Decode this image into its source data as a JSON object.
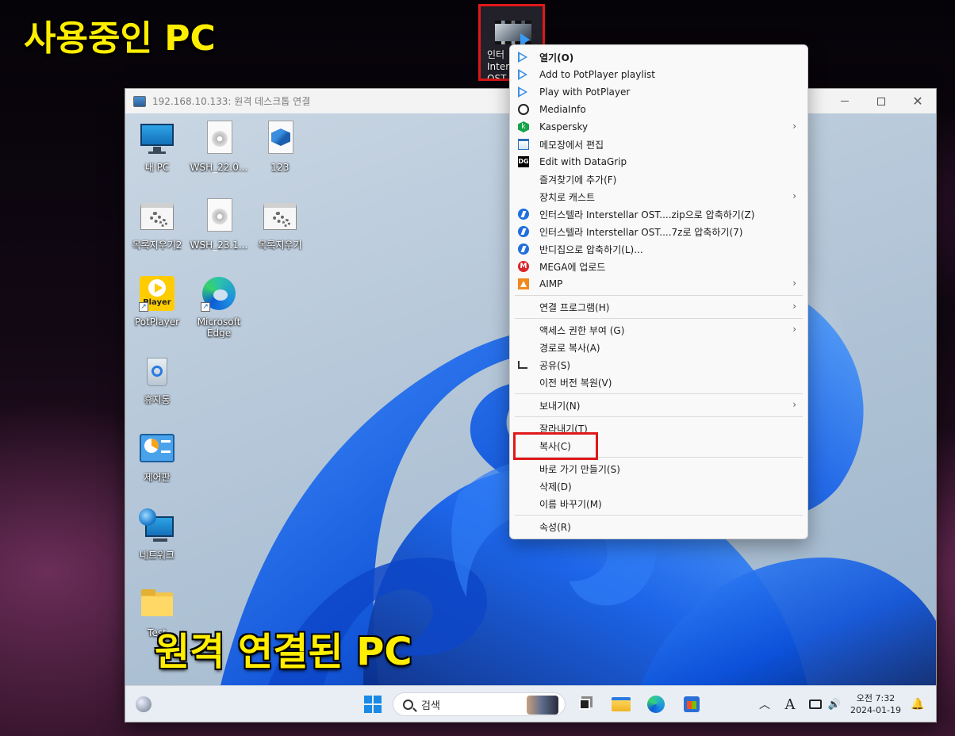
{
  "overlays": {
    "top_label": "사용중인 PC",
    "bottom_label": "원격 연결된 PC"
  },
  "host_icon": {
    "name": "인터\nInter\nOST\nSten"
  },
  "rdp_window": {
    "title": "192.168.10.133: 원격 데스크톱 연결",
    "minimize": "minimize",
    "maximize": "maximize",
    "close": "✕"
  },
  "desktop_icons": [
    {
      "label": "내 PC",
      "icon": "monitor-icon"
    },
    {
      "label": "WSH_22.0...",
      "icon": "document-disc-icon"
    },
    {
      "label": "123",
      "icon": "document-cubes-icon"
    },
    {
      "label": "목록지우기2",
      "icon": "gear-window-icon"
    },
    {
      "label": "WSH_23.1...",
      "icon": "document-disc-icon"
    },
    {
      "label": "목록지우기",
      "icon": "gear-window-icon"
    },
    {
      "label": "PotPlayer",
      "icon": "potplayer-icon",
      "badge": "Player"
    },
    {
      "label": "Microsoft\nEdge",
      "icon": "edge-icon"
    },
    {
      "label": "휴지통",
      "icon": "recycle-bin-icon"
    },
    {
      "label": "제어판",
      "icon": "control-panel-icon"
    },
    {
      "label": "네트워크",
      "icon": "network-icon"
    },
    {
      "label": "Test",
      "icon": "folder-icon"
    }
  ],
  "taskbar": {
    "search_placeholder": "검색",
    "clock_time": "오전 7:32",
    "clock_date": "2024-01-19",
    "ime": "A",
    "chevron": "︿",
    "volume": "🔊",
    "bell": "🔔"
  },
  "context_menu": {
    "items": [
      {
        "label": "열기(O)",
        "icon": "play-icon",
        "bold": true
      },
      {
        "label": "Add to PotPlayer playlist",
        "icon": "play-icon"
      },
      {
        "label": "Play with PotPlayer",
        "icon": "play-icon"
      },
      {
        "label": "MediaInfo",
        "icon": "mediainfo-icon"
      },
      {
        "label": "Kaspersky",
        "icon": "kaspersky-icon",
        "submenu": true,
        "icon_text": "k"
      },
      {
        "label": "메모장에서 편집",
        "icon": "notepad-icon"
      },
      {
        "label": "Edit with DataGrip",
        "icon": "datagrip-icon",
        "icon_text": "DG"
      },
      {
        "label": "즐겨찾기에 추가(F)",
        "icon": ""
      },
      {
        "label": "장치로 캐스트",
        "icon": "",
        "submenu": true
      },
      {
        "label": "인터스텔라 Interstellar OST....zip으로 압축하기(Z)",
        "icon": "bandizip-icon"
      },
      {
        "label": "인터스텔라 Interstellar OST....7z로 압축하기(7)",
        "icon": "bandizip-icon"
      },
      {
        "label": "반디집으로 압축하기(L)...",
        "icon": "bandizip-icon"
      },
      {
        "label": "MEGA에 업로드",
        "icon": "mega-icon",
        "icon_text": "M"
      },
      {
        "label": "AIMP",
        "icon": "aimp-icon",
        "submenu": true
      },
      {
        "sep": true
      },
      {
        "label": "연결 프로그램(H)",
        "icon": "",
        "submenu": true
      },
      {
        "sep": true
      },
      {
        "label": "액세스 권한 부여 (G)",
        "icon": "",
        "submenu": true
      },
      {
        "label": "경로로 복사(A)",
        "icon": ""
      },
      {
        "label": "공유(S)",
        "icon": "share-icon"
      },
      {
        "label": "이전 버전 복원(V)",
        "icon": ""
      },
      {
        "sep": true
      },
      {
        "label": "보내기(N)",
        "icon": "",
        "submenu": true
      },
      {
        "sep": true
      },
      {
        "label": "잘라내기(T)",
        "icon": ""
      },
      {
        "label": "복사(C)",
        "icon": ""
      },
      {
        "sep": true
      },
      {
        "label": "바로 가기 만들기(S)",
        "icon": ""
      },
      {
        "label": "삭제(D)",
        "icon": ""
      },
      {
        "label": "이름 바꾸기(M)",
        "icon": ""
      },
      {
        "sep": true
      },
      {
        "label": "속성(R)",
        "icon": ""
      }
    ]
  },
  "colors": {
    "highlight_box": "#e01818",
    "overlay_text": "#ffee00"
  }
}
